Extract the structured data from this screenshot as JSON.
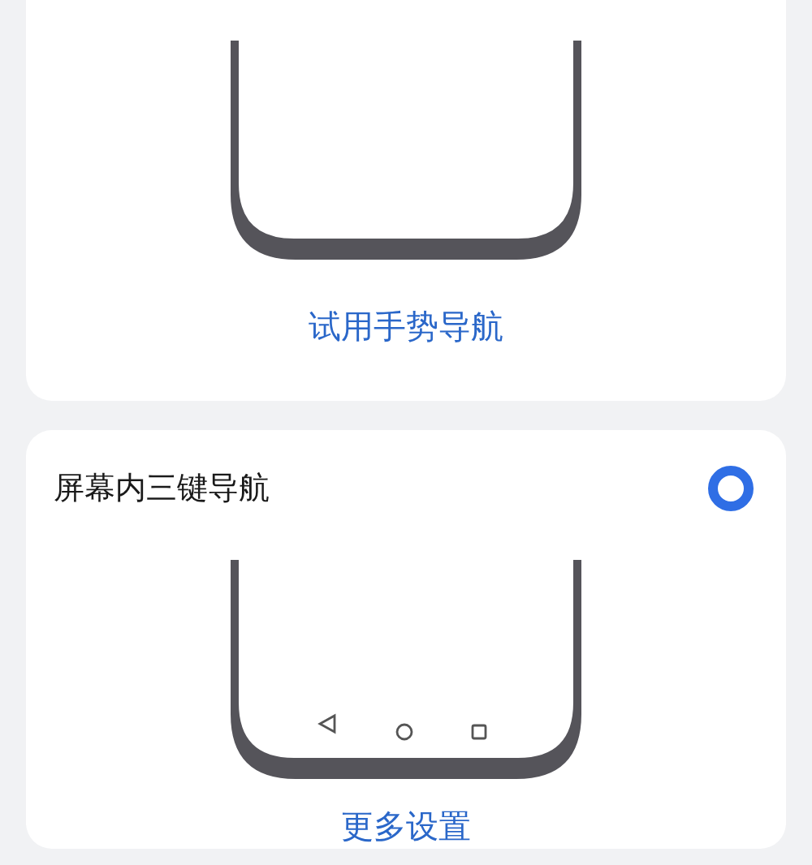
{
  "options": [
    {
      "link": "试用手势导航",
      "nav_buttons": false
    },
    {
      "title": "屏幕内三键导航",
      "selected": true,
      "nav_buttons": true,
      "link": "更多设置"
    }
  ]
}
